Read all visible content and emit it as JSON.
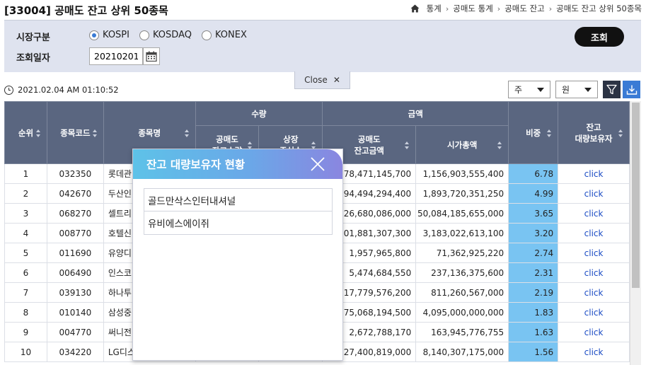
{
  "header": {
    "title": "[33004] 공매도 잔고 상위 50종목",
    "breadcrumb": [
      "통계",
      "공매도 통계",
      "공매도 잔고",
      "공매도 잔고 상위 50종목"
    ]
  },
  "filters": {
    "market_label": "시장구분",
    "date_label": "조회일자",
    "markets": [
      {
        "label": "KOSPI",
        "selected": true
      },
      {
        "label": "KOSDAQ",
        "selected": false
      },
      {
        "label": "KONEX",
        "selected": false
      }
    ],
    "date_value": "20210201",
    "search_label": "조회",
    "close_label": "Close"
  },
  "toolbar": {
    "timestamp": "2021.02.04 AM 01:10:52",
    "unit_select": "주",
    "currency_select": "원"
  },
  "table": {
    "headers": {
      "rank": "순위",
      "code": "종목코드",
      "name": "종목명",
      "qty_group": "수량",
      "short_qty_line1": "공매도",
      "short_qty_line2": "잔고수량",
      "listed_line1": "상장",
      "listed_line2": "주식수",
      "amount_group": "금액",
      "short_amt_line1": "공매도",
      "short_amt_line2": "잔고금액",
      "market_cap": "시가총액",
      "ratio": "비중",
      "holder_line1": "잔고",
      "holder_line2": "대량보유자"
    },
    "rows": [
      {
        "rank": "1",
        "code": "032350",
        "name": "롯데관",
        "short_amt": "78,471,145,700",
        "market_cap": "1,156,903,555,400",
        "ratio": "6.78",
        "holder": "click"
      },
      {
        "rank": "2",
        "code": "042670",
        "name": "두산인",
        "short_amt": "94,494,294,400",
        "market_cap": "1,893,720,351,250",
        "ratio": "4.99",
        "holder": "click"
      },
      {
        "rank": "3",
        "code": "068270",
        "name": "셀트리",
        "short_amt": "26,680,086,000",
        "market_cap": "50,084,185,655,000",
        "ratio": "3.65",
        "holder": "click"
      },
      {
        "rank": "4",
        "code": "008770",
        "name": "호텔신",
        "short_amt": "101,881,307,300",
        "market_cap": "3,183,022,613,100",
        "ratio": "3.20",
        "holder": "click"
      },
      {
        "rank": "5",
        "code": "011690",
        "name": "유양디",
        "short_amt": "1,957,965,800",
        "market_cap": "71,362,925,220",
        "ratio": "2.74",
        "holder": "click"
      },
      {
        "rank": "6",
        "code": "006490",
        "name": "인스코",
        "short_amt": "5,474,684,550",
        "market_cap": "237,136,375,600",
        "ratio": "2.31",
        "holder": "click"
      },
      {
        "rank": "7",
        "code": "039130",
        "name": "하나투",
        "short_amt": "17,779,576,200",
        "market_cap": "811,260,567,000",
        "ratio": "2.19",
        "holder": "click"
      },
      {
        "rank": "8",
        "code": "010140",
        "name": "삼성중",
        "short_amt": "75,068,194,500",
        "market_cap": "4,095,000,000,000",
        "ratio": "1.83",
        "holder": "click"
      },
      {
        "rank": "9",
        "code": "004770",
        "name": "써니전",
        "short_amt": "2,672,788,170",
        "market_cap": "163,945,776,755",
        "ratio": "1.63",
        "holder": "click"
      },
      {
        "rank": "10",
        "code": "034220",
        "name": "LG디스",
        "short_amt": "127,400,819,000",
        "market_cap": "8,140,307,175,000",
        "ratio": "1.56",
        "holder": "click"
      }
    ]
  },
  "modal": {
    "title": "잔고 대량보유자 현황",
    "holders": [
      "골드만삭스인터내셔널",
      "유비에스에이쥐"
    ]
  },
  "colors": {
    "header_bg": "#5a6680",
    "filter_bg": "#dfe3ef",
    "ratio_bg": "#79c4f2",
    "link": "#1a4bc4",
    "accent_blue": "#3a7bd5"
  }
}
